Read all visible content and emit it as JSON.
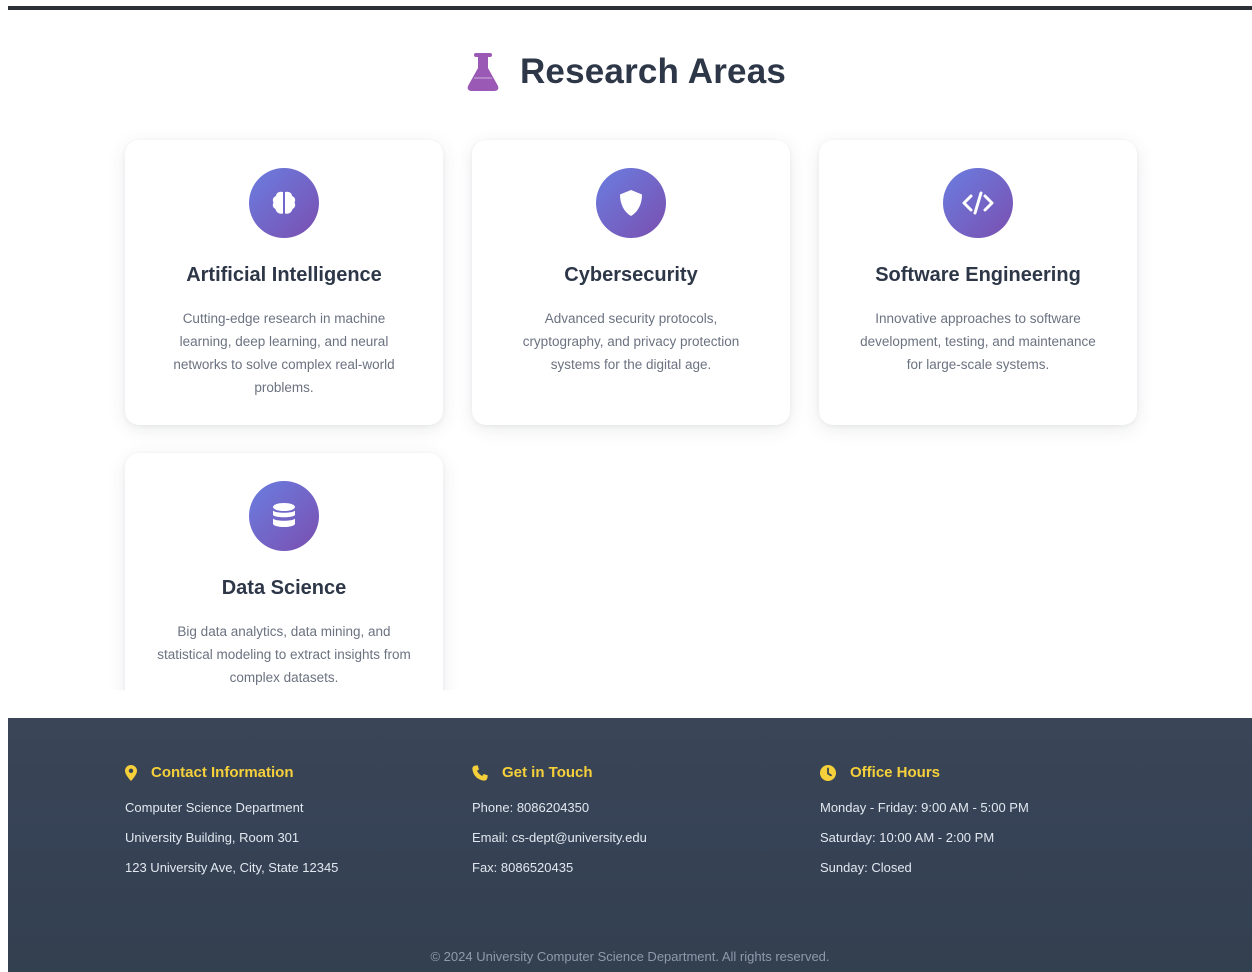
{
  "section": {
    "title": "Research Areas",
    "icon": "flask-icon",
    "icon_color": "#9b59b6"
  },
  "cards": [
    {
      "icon": "brain-icon",
      "title": "Artificial Intelligence",
      "description": "Cutting-edge research in machine learning, deep learning, and neural networks to solve complex real-world problems."
    },
    {
      "icon": "shield-icon",
      "title": "Cybersecurity",
      "description": "Advanced security protocols, cryptography, and privacy protection systems for the digital age."
    },
    {
      "icon": "code-icon",
      "title": "Software Engineering",
      "description": "Innovative approaches to software development, testing, and maintenance for large-scale systems."
    },
    {
      "icon": "database-icon",
      "title": "Data Science",
      "description": "Big data analytics, data mining, and statistical modeling to extract insights from complex datasets."
    }
  ],
  "colors": {
    "accent_gradient_start": "#6a7ee0",
    "accent_gradient_end": "#7a4fb0",
    "footer_heading": "#f6d03a",
    "footer_bg": "#364255"
  },
  "footer": {
    "contact": {
      "icon": "map-marker-icon",
      "title": "Contact Information",
      "lines": [
        "Computer Science Department",
        "University Building, Room 301",
        "123 University Ave, City, State 12345"
      ]
    },
    "touch": {
      "icon": "phone-icon",
      "title": "Get in Touch",
      "lines": [
        "Phone: 8086204350",
        "Email: cs-dept@university.edu",
        "Fax: 8086520435"
      ]
    },
    "hours": {
      "icon": "clock-icon",
      "title": "Office Hours",
      "lines": [
        "Monday - Friday: 9:00 AM - 5:00 PM",
        "Saturday: 10:00 AM - 2:00 PM",
        "Sunday: Closed"
      ]
    },
    "copyright": "© 2024 University Computer Science Department. All rights reserved."
  }
}
